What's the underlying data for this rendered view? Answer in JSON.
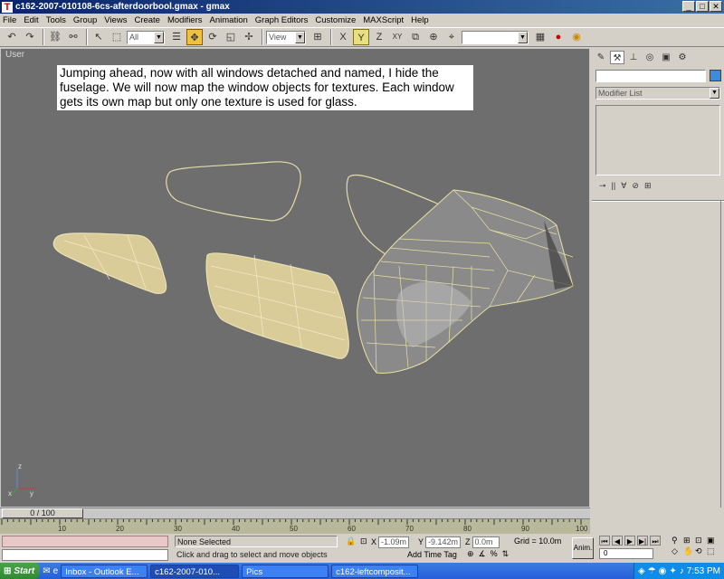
{
  "window": {
    "title": "c162-2007-010108-6cs-afterdoorbool.gmax - gmax",
    "controls": [
      "_",
      "□",
      "✕"
    ]
  },
  "menu": [
    "File",
    "Edit",
    "Tools",
    "Group",
    "Views",
    "Create",
    "Modifiers",
    "Animation",
    "Graph Editors",
    "Customize",
    "MAXScript",
    "Help"
  ],
  "toolbar": {
    "selection_filter": "All",
    "reference_coord": "View",
    "named_selection": ""
  },
  "viewport": {
    "label": "User",
    "annotation": "Jumping ahead, now with all windows detached and named, I hide the fuselage.  We will now map the window objects for textures.  Each window gets its own map but only one texture is used for glass.",
    "axis_labels": [
      "z",
      "y",
      "x"
    ]
  },
  "command_panel": {
    "modifier_list": "Modifier List",
    "object_color": "#3c8cdc"
  },
  "timeline": {
    "slider_label": "0 / 100",
    "ticks": [
      "10",
      "20",
      "30",
      "40",
      "50",
      "60",
      "70",
      "80",
      "90",
      "100"
    ]
  },
  "status": {
    "selection": "None Selected",
    "prompt": "Click and drag to select and move objects",
    "x_label": "X",
    "x_value": "-1.09m",
    "y_label": "Y",
    "y_value": "-9.142m",
    "z_label": "Z",
    "z_value": "0.0m",
    "grid": "Grid = 10.0m",
    "add_time_tag": "Add Time Tag",
    "anim_button": "Anim.",
    "frame": "0"
  },
  "taskbar": {
    "start": "Start",
    "tasks": [
      "Inbox - Outlook E...",
      "c162-2007-010...",
      "Pics",
      "c162-leftcomposit..."
    ],
    "clock": "7:53 PM"
  }
}
